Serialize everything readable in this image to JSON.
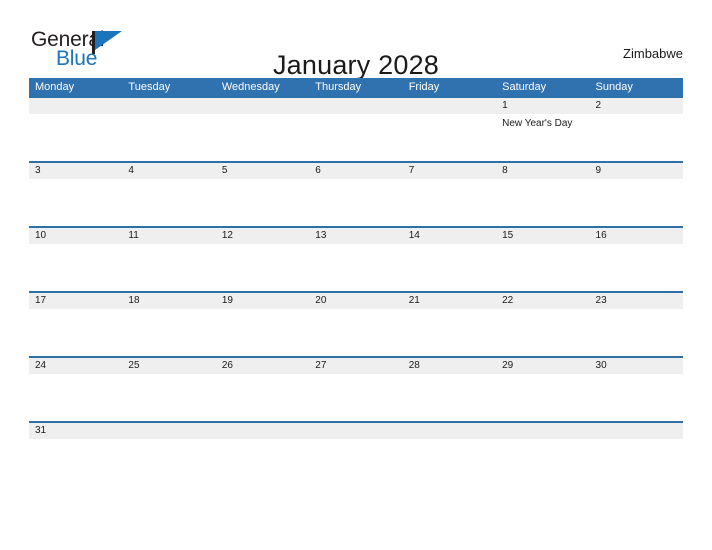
{
  "brand": {
    "name_part1": "General",
    "name_part2": "Blue",
    "flag_icon": "flag-icon"
  },
  "header": {
    "title": "January 2028",
    "region": "Zimbabwe"
  },
  "calendar": {
    "weekday_headers": [
      "Monday",
      "Tuesday",
      "Wednesday",
      "Thursday",
      "Friday",
      "Saturday",
      "Sunday"
    ],
    "header_bg_color": "#3071b0",
    "row_border_color": "#2f6fa8",
    "day_band_color": "#efefef",
    "weeks": [
      {
        "days": [
          {
            "date": "",
            "event": ""
          },
          {
            "date": "",
            "event": ""
          },
          {
            "date": "",
            "event": ""
          },
          {
            "date": "",
            "event": ""
          },
          {
            "date": "",
            "event": ""
          },
          {
            "date": "1",
            "event": "New Year's Day"
          },
          {
            "date": "2",
            "event": ""
          }
        ]
      },
      {
        "days": [
          {
            "date": "3",
            "event": ""
          },
          {
            "date": "4",
            "event": ""
          },
          {
            "date": "5",
            "event": ""
          },
          {
            "date": "6",
            "event": ""
          },
          {
            "date": "7",
            "event": ""
          },
          {
            "date": "8",
            "event": ""
          },
          {
            "date": "9",
            "event": ""
          }
        ]
      },
      {
        "days": [
          {
            "date": "10",
            "event": ""
          },
          {
            "date": "11",
            "event": ""
          },
          {
            "date": "12",
            "event": ""
          },
          {
            "date": "13",
            "event": ""
          },
          {
            "date": "14",
            "event": ""
          },
          {
            "date": "15",
            "event": ""
          },
          {
            "date": "16",
            "event": ""
          }
        ]
      },
      {
        "days": [
          {
            "date": "17",
            "event": ""
          },
          {
            "date": "18",
            "event": ""
          },
          {
            "date": "19",
            "event": ""
          },
          {
            "date": "20",
            "event": ""
          },
          {
            "date": "21",
            "event": ""
          },
          {
            "date": "22",
            "event": ""
          },
          {
            "date": "23",
            "event": ""
          }
        ]
      },
      {
        "days": [
          {
            "date": "24",
            "event": ""
          },
          {
            "date": "25",
            "event": ""
          },
          {
            "date": "26",
            "event": ""
          },
          {
            "date": "27",
            "event": ""
          },
          {
            "date": "28",
            "event": ""
          },
          {
            "date": "29",
            "event": ""
          },
          {
            "date": "30",
            "event": ""
          }
        ]
      },
      {
        "days": [
          {
            "date": "31",
            "event": ""
          },
          {
            "date": "",
            "event": ""
          },
          {
            "date": "",
            "event": ""
          },
          {
            "date": "",
            "event": ""
          },
          {
            "date": "",
            "event": ""
          },
          {
            "date": "",
            "event": ""
          },
          {
            "date": "",
            "event": ""
          }
        ]
      }
    ]
  }
}
